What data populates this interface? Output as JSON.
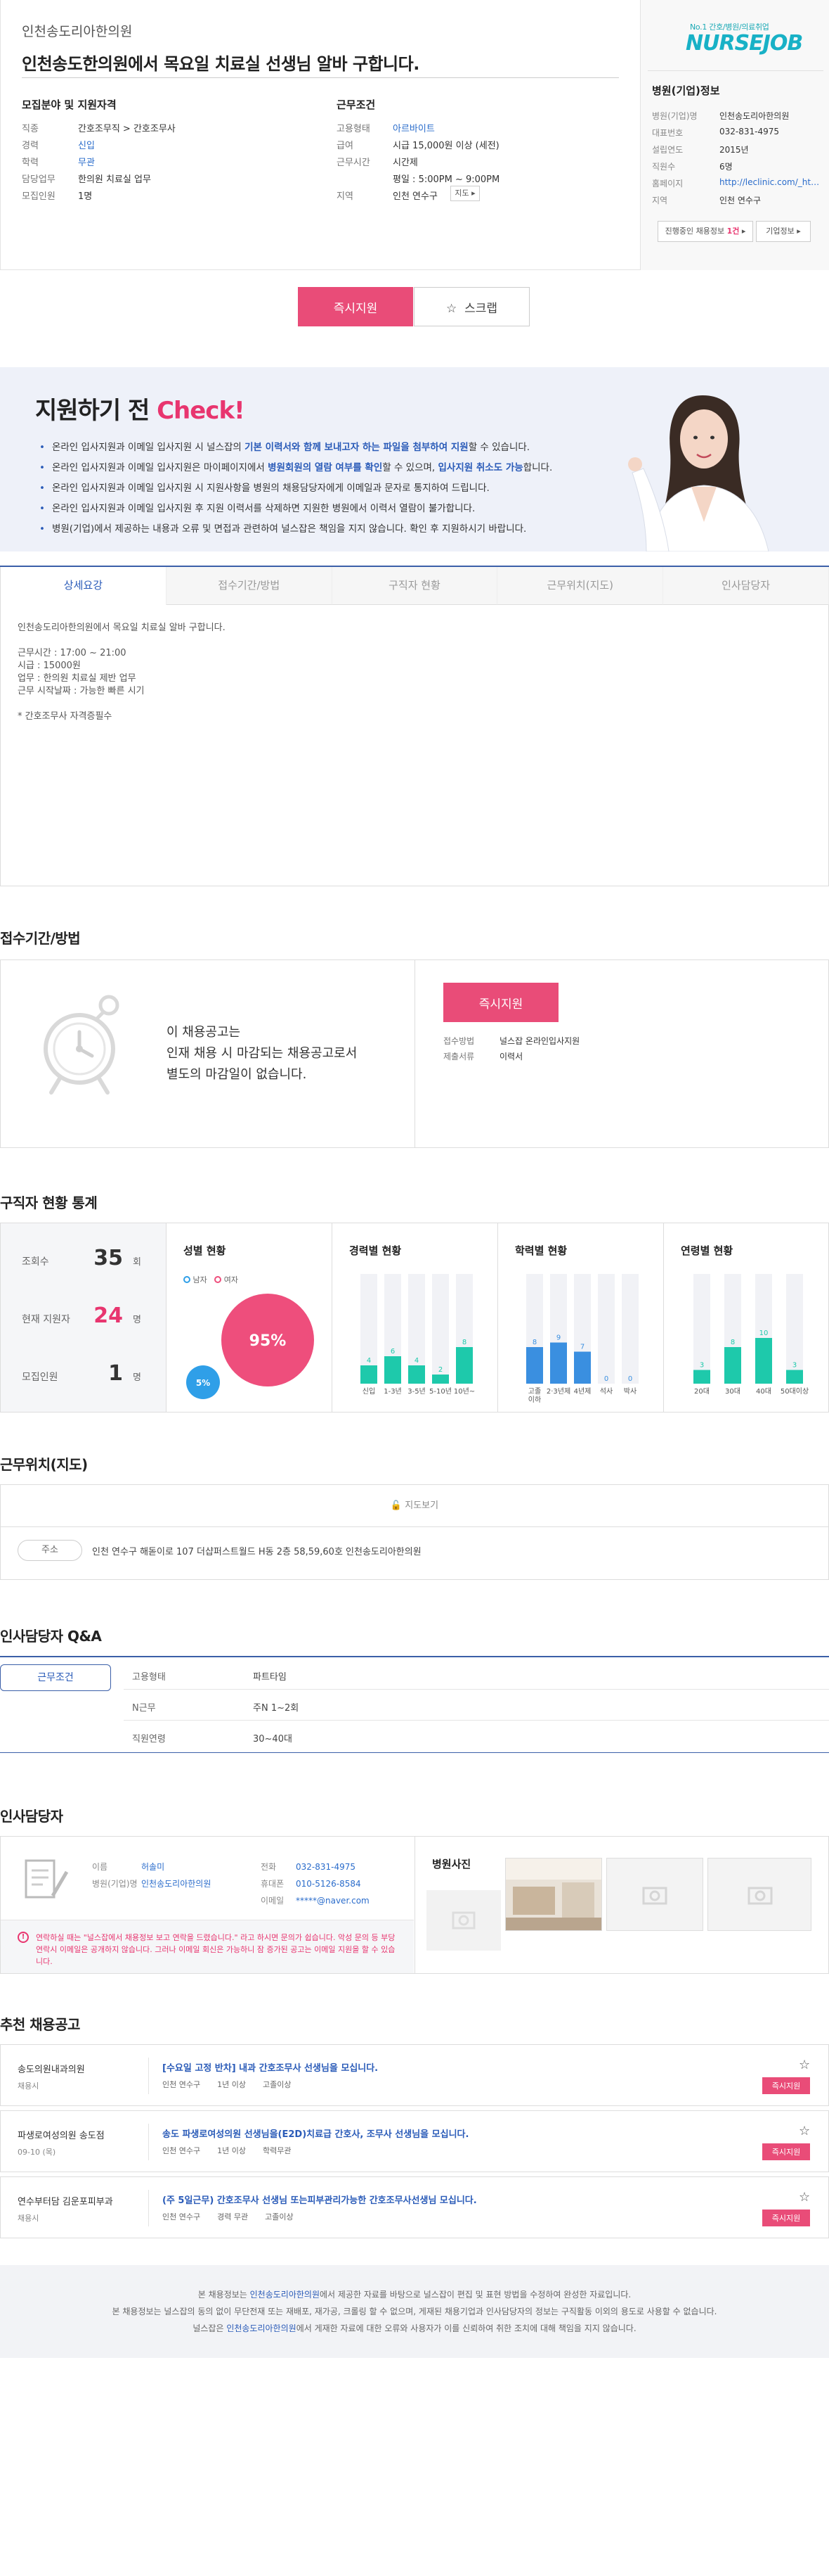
{
  "header": {
    "clinic_name": "인천송도리아한의원",
    "job_title": "인천송도한의원에서 목요일 치료실 선생님 알바 구합니다."
  },
  "recruit": {
    "heading": "모집분야 및 지원자격",
    "rows": [
      {
        "k": "직종",
        "v": "간호조무직 > 간호조무사"
      },
      {
        "k": "경력",
        "v": "신입"
      },
      {
        "k": "학력",
        "v": "무관"
      },
      {
        "k": "담당업무",
        "v": "한의원 치료실 업무"
      },
      {
        "k": "모집인원",
        "v": "1명"
      }
    ]
  },
  "conditions": {
    "heading": "근무조건",
    "rows": [
      {
        "k": "고용형태",
        "v": "아르바이트"
      },
      {
        "k": "급여",
        "v": "시급 15,000원 이상 (세전)"
      },
      {
        "k": "근무시간",
        "v": "시간제"
      },
      {
        "k": "",
        "v": "평일 : 5:00PM ~ 9:00PM"
      },
      {
        "k": "지역",
        "v": "인천 연수구"
      }
    ],
    "map_button": "지도"
  },
  "corp": {
    "logo_tagline": "No.1 간호/병원/의료취업",
    "logo_name": "NURSEJOB",
    "heading": "병원(기업)정보",
    "rows": [
      {
        "k": "병원(기업)명",
        "v": "인천송도리아한의원"
      },
      {
        "k": "대표번호",
        "v": "032-831-4975"
      },
      {
        "k": "설립연도",
        "v": "2015년"
      },
      {
        "k": "직원수",
        "v": "6명"
      },
      {
        "k": "홈페이지",
        "v": "http://leclinic.com/_html/ind..."
      },
      {
        "k": "지역",
        "v": "인천 연수구"
      }
    ],
    "jobs_btn_prefix": "진행중인 채용정보",
    "jobs_btn_count": "1건",
    "info_btn": "기업정보"
  },
  "actions": {
    "apply": "즉시지원",
    "scrap": "스크랩"
  },
  "banner": {
    "title_prefix": "지원하기 전",
    "title_accent": "Check!",
    "items": [
      {
        "pre": "온라인 입사지원과 이메일 입사지원 시 널스잡의 ",
        "bold": "기본 이력서와 함께 보내고자 하는 파일을 첨부하여 지원",
        "post": "할 수 있습니다."
      },
      {
        "pre": "온라인 입사지원과 이메일 입사지원은 마이페이지에서 ",
        "bold": "병원회원의 열람 여부를 확인",
        "post": "할 수 있으며, ",
        "bold2": "입사지원 취소도 가능",
        "post2": "합니다."
      },
      {
        "pre": "온라인 입사지원과 이메일 입사지원 시 지원사항을 병원의 채용담당자에게 이메일과 문자로 통지하여 드립니다.",
        "bold": "",
        "post": ""
      },
      {
        "pre": "온라인 입사지원과 이메일 입사지원 후 지원 이력서를 삭제하면 지원한 병원에서 이력서 열람이 불가합니다.",
        "bold": "",
        "post": ""
      },
      {
        "pre": "병원(기업)에서 제공하는 내용과 오류 및 면접과 관련하여 널스잡은 책임을 지지 않습니다. 확인 후 지원하시기 바랍니다.",
        "bold": "",
        "post": ""
      }
    ]
  },
  "tabs": [
    "상세요강",
    "접수기간/방법",
    "구직자 현황",
    "근무위치(지도)",
    "인사담당자"
  ],
  "detail": {
    "lines": "인천송도리아한의원에서 목요일 치료실 알바 구합니다.\n\n근무시간 : 17:00 ~ 21:00\n시급 : 15000원\n업무 : 한의원 치료실 제반 업무\n근무 시작날짜 : 가능한 빠른 시기\n\n* 간호조무사 자격증필수"
  },
  "deadline": {
    "title": "접수기간/방법",
    "message": "이 채용공고는\n인재 채용 시 마감되는 채용공고로서\n별도의 마감일이 없습니다.",
    "apply": "즉시지원",
    "rows": [
      {
        "k": "접수방법",
        "v": "널스잡 온라인입사지원"
      },
      {
        "k": "제출서류",
        "v": "이력서"
      }
    ]
  },
  "stats": {
    "title": "구직자 현황 통계",
    "summary": [
      {
        "label": "조회수",
        "value": "35",
        "unit": "회"
      },
      {
        "label": "현재 지원자",
        "value": "24",
        "unit": "명"
      },
      {
        "label": "모집인원",
        "value": "1",
        "unit": "명"
      }
    ],
    "gender_title": "성별 현황",
    "gender_legend": [
      "남자",
      "여자"
    ],
    "gender_values": [
      "5%",
      "95%"
    ]
  },
  "chart_data": [
    {
      "type": "pie",
      "title": "성별 현황",
      "categories": [
        "남자",
        "여자"
      ],
      "values": [
        5,
        95
      ],
      "colors": [
        "#2f9fe8",
        "#ee4e7c"
      ]
    },
    {
      "type": "bar",
      "title": "경력별 현황",
      "categories": [
        "신입",
        "1-3년",
        "3-5년",
        "5-10년",
        "10년~"
      ],
      "values": [
        4,
        6,
        4,
        2,
        8
      ],
      "ylim": [
        0,
        24
      ],
      "color": "#1ec9ab"
    },
    {
      "type": "bar",
      "title": "학력별 현황",
      "categories": [
        "고졸이하",
        "2·3년제",
        "4년제",
        "석사",
        "박사"
      ],
      "values": [
        8,
        9,
        7,
        0,
        0
      ],
      "ylim": [
        0,
        24
      ],
      "color": "#3a8fe0"
    },
    {
      "type": "bar",
      "title": "연령별 현황",
      "categories": [
        "20대",
        "30대",
        "40대",
        "50대이상"
      ],
      "values": [
        3,
        8,
        10,
        3
      ],
      "ylim": [
        0,
        24
      ],
      "color": "#1ec9ab"
    }
  ],
  "map": {
    "title": "근무위치(지도)",
    "toggle": "지도보기",
    "addr_label": "주소",
    "address": "인천 연수구 해돋이로 107 더샵퍼스트월드 H동 2층 58,59,60호 인천송도리아한의원"
  },
  "qa": {
    "title": "인사담당자 Q&A",
    "tag": "근무조건",
    "rows": [
      {
        "k": "고용형태",
        "v": "파트타임"
      },
      {
        "k": "N근무",
        "v": "주N 1~2회"
      },
      {
        "k": "직원연령",
        "v": "30~40대"
      }
    ]
  },
  "manager": {
    "title": "인사담당자",
    "left_rows": [
      {
        "k": "이름",
        "v": "허솔미"
      },
      {
        "k": "병원(기업)명",
        "v": "인천송도리아한의원"
      }
    ],
    "right_rows": [
      {
        "k": "전화",
        "v": "032-831-4975"
      },
      {
        "k": "휴대폰",
        "v": "010-5126-8584"
      },
      {
        "k": "이메일",
        "v": "*****@naver.com"
      }
    ],
    "warning": "연락하실 때는 \"널스잡에서 채용정보 보고 연락을 드렸습니다.\" 라고 하시면 문의가 쉽습니다. 악성 문의 등 부당 연락시 이메일은 공개하지 않습니다. 그러나 이메일 회신은 가능하니 잠 증가된 공고는 이메일 지원을 할 수 있습니다.",
    "photo_title": "병원사진"
  },
  "recommend": {
    "title": "추천 채용공고",
    "items": [
      {
        "org": "송도의원내과의원",
        "sub": "채용시",
        "title": "[수요일 고정 반차] 내과 간호조무사 선생님을 모십니다.",
        "meta": [
          "인천 연수구",
          "1년 이상",
          "고졸이상"
        ],
        "btn": "즉시지원"
      },
      {
        "org": "파생로여성의원 송도점",
        "sub": "09-10 (목)",
        "title": "송도 파생로여성의원 선생님을(E2D)치료급 간호사, 조무사 선생님을 모십니다.",
        "meta": [
          "인천 연수구",
          "1년 이상",
          "학력무관"
        ],
        "btn": "즉시지원"
      },
      {
        "org": "연수부터담 김운포피부과",
        "sub": "채용시",
        "title": "(주 5일근무) 간호조무사 선생님 또는피부관리가능한 간호조무사선생님 모십니다.",
        "meta": [
          "인천 연수구",
          "경력 무관",
          "고졸이상"
        ],
        "btn": "즉시지원"
      }
    ]
  },
  "footer": {
    "l1_pre": "본 채용정보는 ",
    "l1_b": "인천송도리아한의원",
    "l1_post": "에서 제공한 자료를 바탕으로 널스잡이 편집 및 표현 방법을 수정하여 완성한 자료입니다.",
    "l2": "본 채용정보는 널스잡의 동의 없이 무단전재 또는 재배포, 재가공, 크롤링 할 수 없으며, 게재된 채용기업과 인사담당자의 정보는 구직활동 이외의 용도로 사용할 수 없습니다.",
    "l3_pre": "널스잡은 ",
    "l3_b": "인천송도리아한의원",
    "l3_post": "에서 게재한 자료에 대한 오류와 사용자가 이를 신뢰하여 취한 조치에 대해 책임을 지지 않습니다."
  }
}
